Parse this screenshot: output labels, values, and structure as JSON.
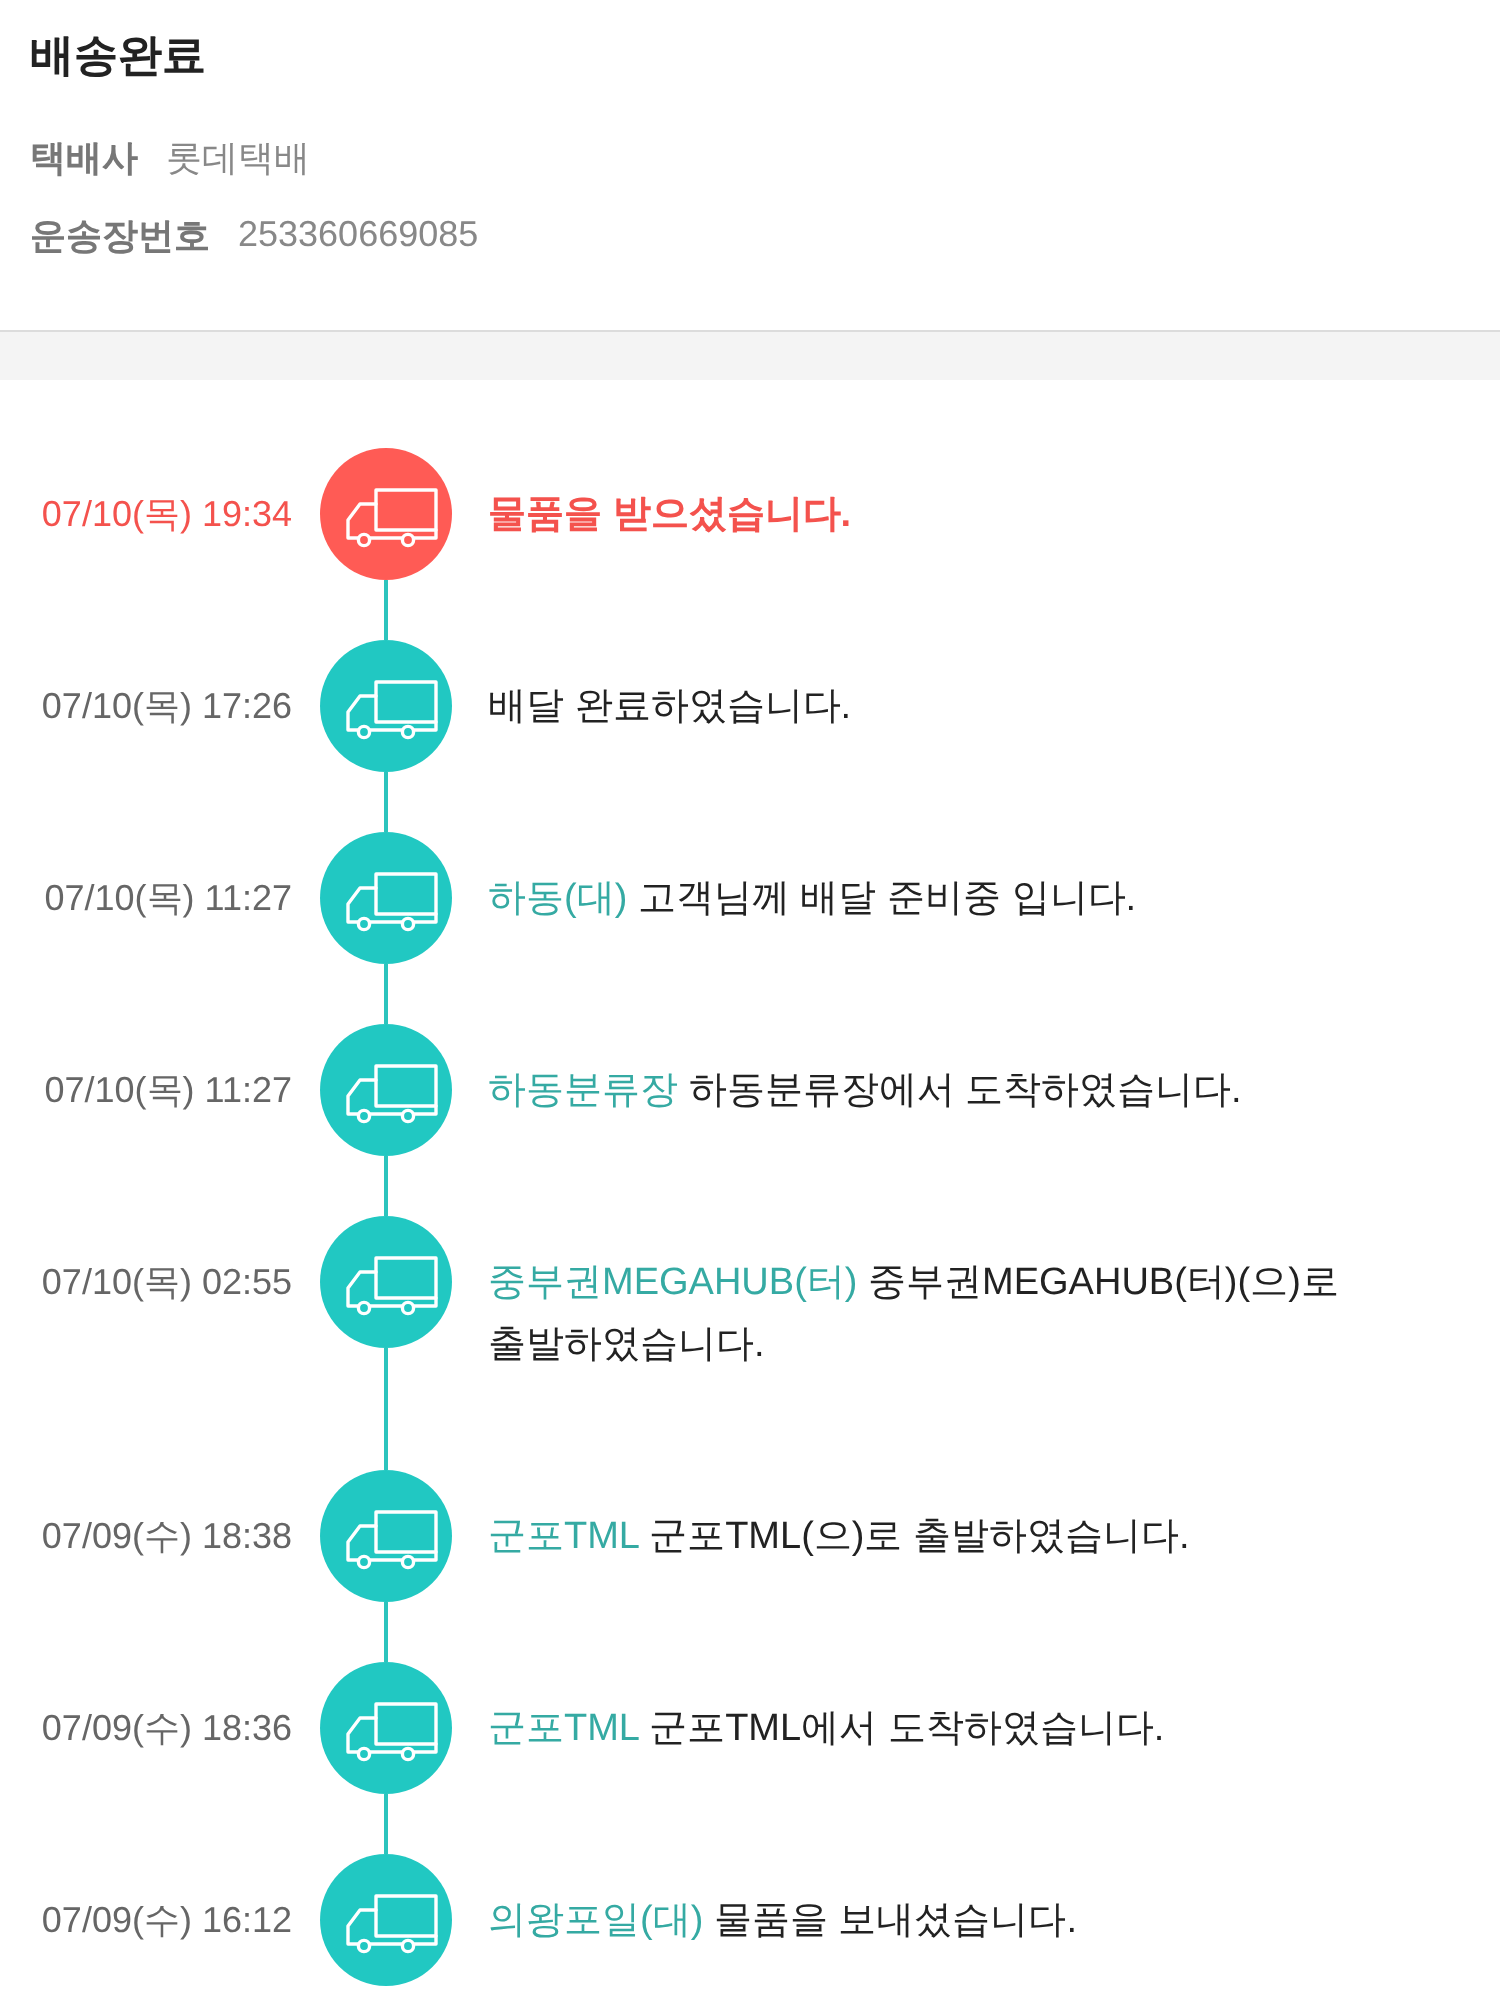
{
  "header": {
    "title": "배송완료",
    "details": [
      {
        "label": "택배사",
        "value": "롯데택배"
      },
      {
        "label": "운송장번호",
        "value": "253360669085"
      }
    ]
  },
  "timeline": [
    {
      "time": "07/10(목) 19:34",
      "message": "물품을 받으셨습니다.",
      "highlighted": true
    },
    {
      "time": "07/10(목) 17:26",
      "message": "배달 완료하였습니다.",
      "highlighted": false
    },
    {
      "time": "07/10(목) 11:27",
      "location": "하동(대)",
      "message": "고객님께 배달 준비중 입니다.",
      "highlighted": false
    },
    {
      "time": "07/10(목) 11:27",
      "location": "하동분류장",
      "message": "하동분류장에서 도착하였습니다.",
      "highlighted": false
    },
    {
      "time": "07/10(목) 02:55",
      "location": "중부권MEGAHUB(터)",
      "message": "중부권MEGAHUB(터)(으)로 출발하였습니다.",
      "highlighted": false
    },
    {
      "time": "07/09(수) 18:38",
      "location": "군포TML",
      "message": "군포TML(으)로 출발하였습니다.",
      "highlighted": false
    },
    {
      "time": "07/09(수) 18:36",
      "location": "군포TML",
      "message": "군포TML에서 도착하였습니다.",
      "highlighted": false
    },
    {
      "time": "07/09(수) 16:12",
      "location": "의왕포일(대)",
      "message": "물품을 보내셨습니다.",
      "highlighted": false
    }
  ]
}
